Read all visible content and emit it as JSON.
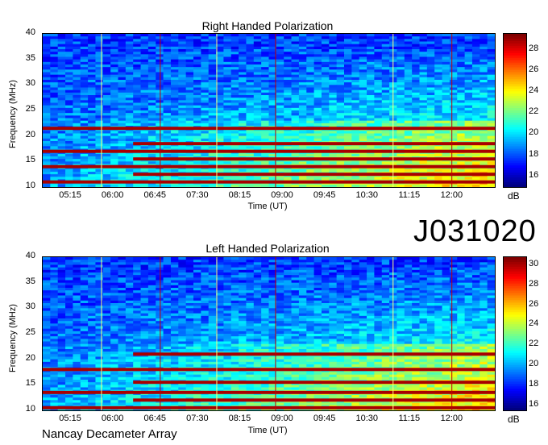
{
  "observation_id": "J031020",
  "footer": "Nancay Decameter Array",
  "chart_data": [
    {
      "type": "heatmap",
      "title": "Right Handed Polarization",
      "xlabel": "Time (UT)",
      "ylabel": "Frequency (MHz)",
      "x_ticks": [
        "05:15",
        "06:00",
        "06:45",
        "07:30",
        "08:15",
        "09:00",
        "09:45",
        "10:30",
        "11:15",
        "12:00"
      ],
      "y_ticks": [
        10,
        15,
        20,
        25,
        30,
        35,
        40
      ],
      "ylim": [
        10,
        40
      ],
      "colorbar": {
        "label": "dB",
        "ticks": [
          16,
          18,
          20,
          22,
          24,
          26,
          28
        ],
        "range": [
          15,
          29.5
        ]
      },
      "strong_bands_mhz": [
        11,
        12.5,
        14,
        15.5,
        17,
        18.5,
        21.5
      ]
    },
    {
      "type": "heatmap",
      "title": "Left Handed Polarization",
      "xlabel": "Time (UT)",
      "ylabel": "Frequency (MHz)",
      "x_ticks": [
        "05:15",
        "06:00",
        "06:45",
        "07:30",
        "08:15",
        "09:00",
        "09:45",
        "10:30",
        "11:15",
        "12:00"
      ],
      "y_ticks": [
        10,
        15,
        20,
        25,
        30,
        35,
        40
      ],
      "ylim": [
        10,
        40
      ],
      "colorbar": {
        "label": "dB",
        "ticks": [
          16,
          18,
          20,
          22,
          24,
          26,
          28,
          30
        ],
        "range": [
          15.5,
          30.8
        ]
      },
      "strong_bands_mhz": [
        10.5,
        12,
        13.5,
        15.5,
        18,
        21
      ]
    }
  ]
}
